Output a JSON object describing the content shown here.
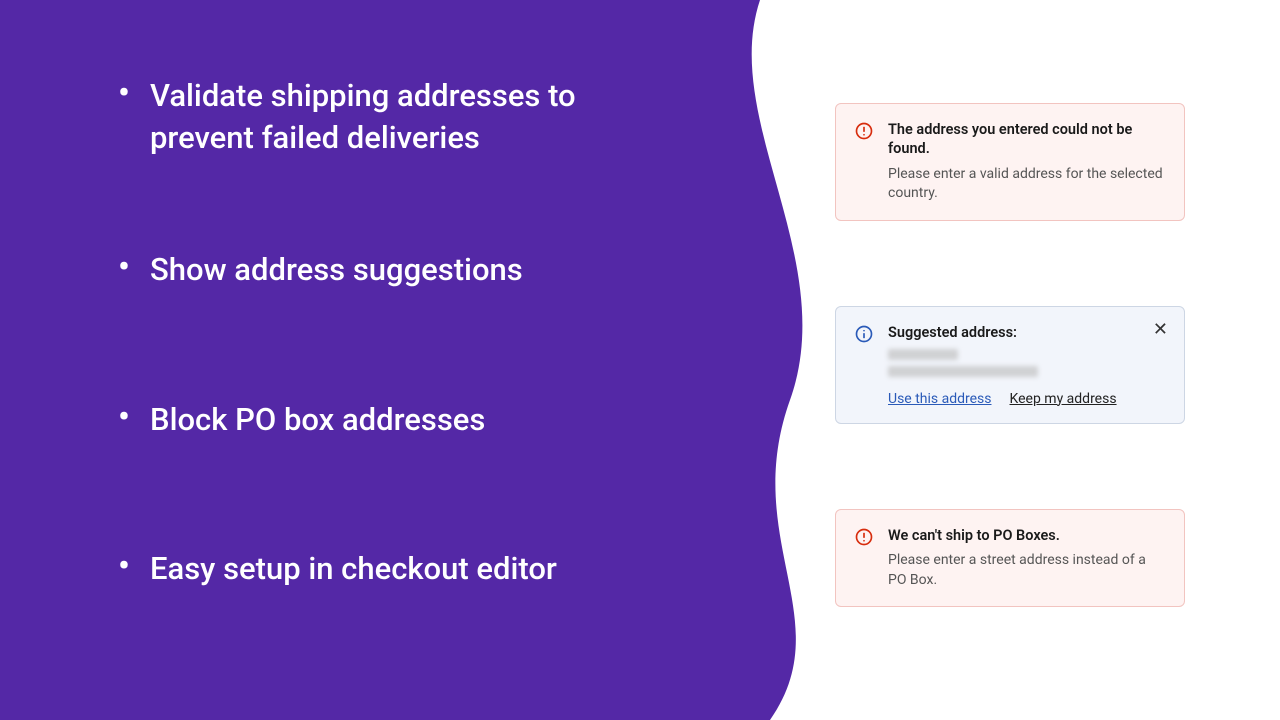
{
  "bullets": [
    "Validate shipping addresses to prevent failed deliveries",
    "Show address suggestions",
    "Block PO box addresses",
    "Easy setup in checkout editor"
  ],
  "error1": {
    "title": "The address you entered could not be found.",
    "text": "Please enter a valid address for the selected country."
  },
  "suggest": {
    "title": "Suggested address:",
    "use": "Use this address",
    "keep": "Keep my address"
  },
  "error2": {
    "title": "We can't ship to PO Boxes.",
    "text": "Please enter a street address instead of a PO Box."
  },
  "colors": {
    "purple": "#5428a6",
    "errorRed": "#d72c0d",
    "infoBlue": "#2a5ab8"
  }
}
